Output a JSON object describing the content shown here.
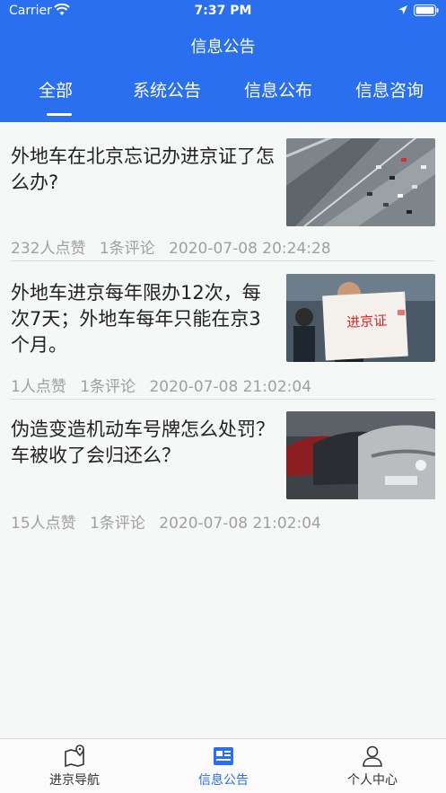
{
  "status_bar": {
    "carrier": "Carrier",
    "time": "7:37 PM"
  },
  "nav": {
    "title": "信息公告"
  },
  "tabs": [
    {
      "label": "全部"
    },
    {
      "label": "系统公告"
    },
    {
      "label": "信息公布"
    },
    {
      "label": "信息咨询"
    }
  ],
  "articles": [
    {
      "title": "外地车在北京忘记办进京证了怎么办?",
      "likes": "232人点赞",
      "comments": "1条评论",
      "time": "2020-07-08 20:24:28"
    },
    {
      "title": "外地车进京每年限办12次，每次7天；外地车每年只能在京3个月。",
      "likes": "1人点赞",
      "comments": "1条评论",
      "time": "2020-07-08 21:02:04"
    },
    {
      "title": "伪造变造机动车号牌怎么处罚？车被收了会归还么？",
      "likes": "15人点赞",
      "comments": "1条评论",
      "time": "2020-07-08 21:02:04"
    }
  ],
  "thumb_texts": {
    "permit": "进京证"
  },
  "tabbar": [
    {
      "label": "进京导航",
      "icon": "map-pin-icon"
    },
    {
      "label": "信息公告",
      "icon": "news-icon"
    },
    {
      "label": "个人中心",
      "icon": "person-icon"
    }
  ],
  "colors": {
    "brand": "#2a6ff0",
    "meta_text": "#a0a0a0",
    "background": "#f6f7f7"
  }
}
